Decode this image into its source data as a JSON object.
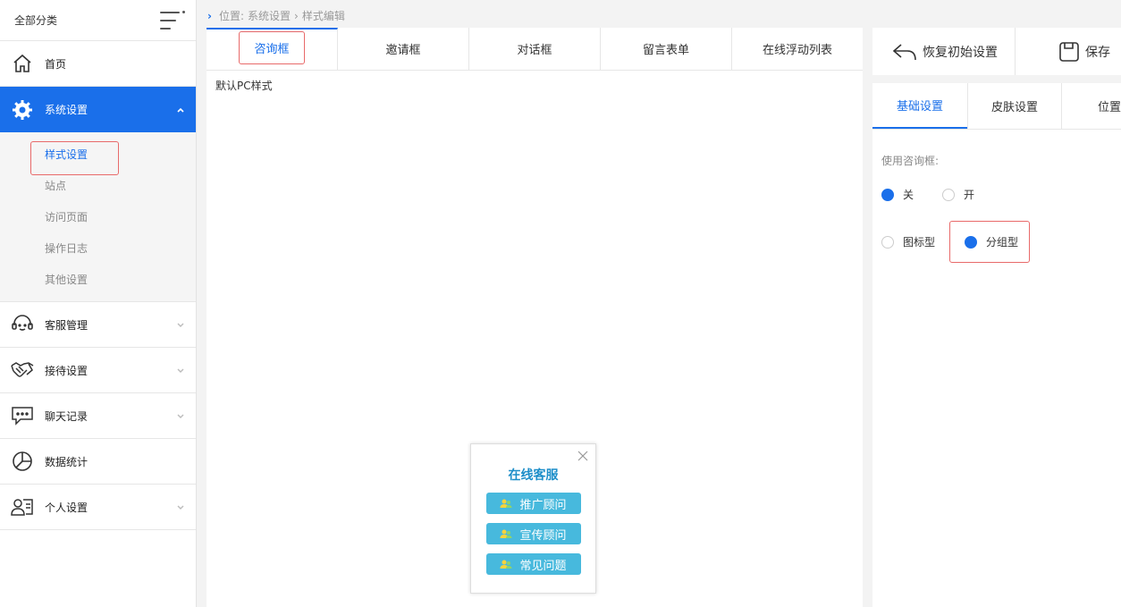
{
  "sidebar": {
    "header_title": "全部分类",
    "items": [
      {
        "label": "首页"
      },
      {
        "label": "系统设置"
      },
      {
        "label": "客服管理"
      },
      {
        "label": "接待设置"
      },
      {
        "label": "聊天记录"
      },
      {
        "label": "数据统计"
      },
      {
        "label": "个人设置"
      }
    ],
    "sub_items": [
      "样式设置",
      "站点",
      "访问页面",
      "操作日志",
      "其他设置"
    ]
  },
  "breadcrumb": {
    "prefix": "位置:",
    "level1": "系统设置",
    "level2": "样式编辑"
  },
  "tabs": [
    "咨询框",
    "邀请框",
    "对话框",
    "留言表单",
    "在线浮动列表"
  ],
  "preview": {
    "style_label": "默认PC样式",
    "widget_title": "在线客服",
    "buttons": [
      "推广顾问",
      "宣传顾问",
      "常见问题"
    ]
  },
  "toolbar": {
    "reset_label": "恢复初始设置",
    "save_label": "保存"
  },
  "settings_tabs": [
    "基础设置",
    "皮肤设置",
    "位置"
  ],
  "settings": {
    "use_label": "使用咨询框:",
    "off_label": "关",
    "on_label": "开",
    "icon_type_label": "图标型",
    "group_type_label": "分组型"
  },
  "colors": {
    "primary": "#1a6fea",
    "highlight_border": "#e86a6a",
    "widget_button": "#47b9dd",
    "widget_title": "#1d8ec9"
  }
}
